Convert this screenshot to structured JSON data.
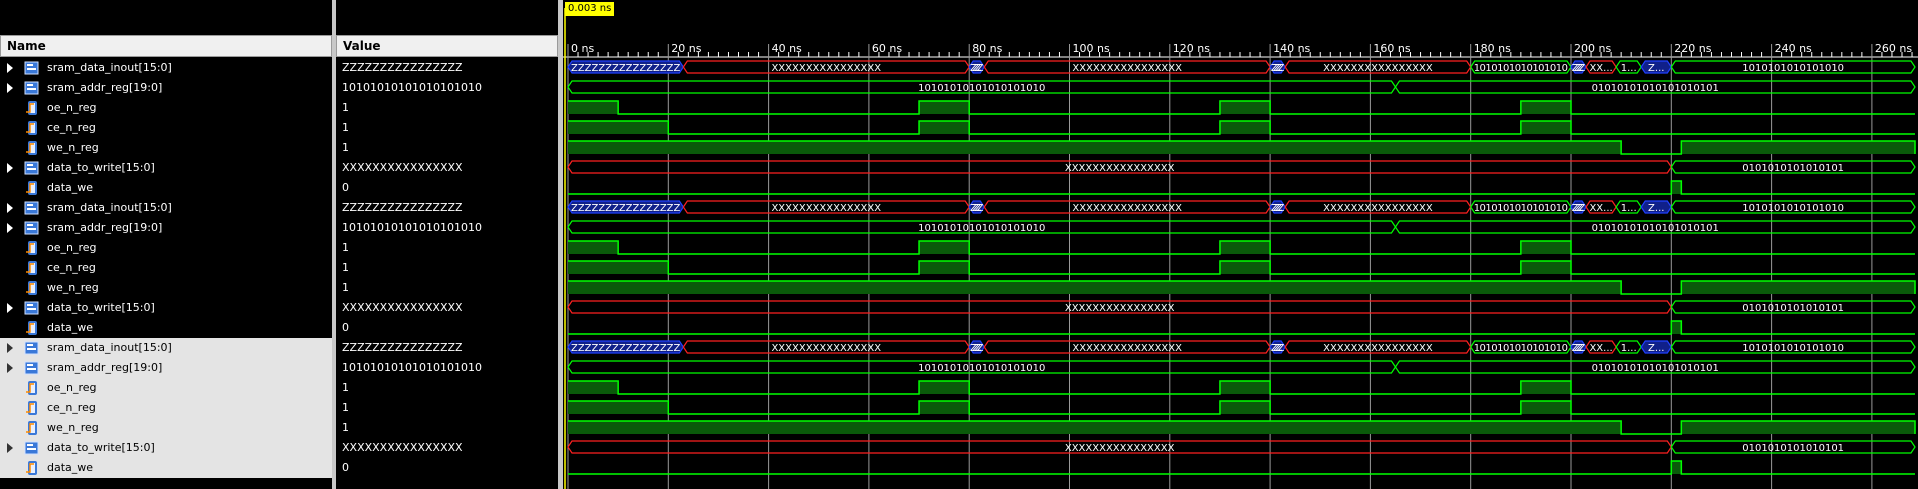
{
  "headers": {
    "name": "Name",
    "value": "Value"
  },
  "cursor": {
    "label": "0.003 ns"
  },
  "time_ticks": [
    "0 ns",
    "20 ns",
    "40 ns",
    "60 ns",
    "80 ns",
    "100 ns",
    "120 ns",
    "140 ns",
    "160 ns",
    "180 ns",
    "200 ns",
    "220 ns",
    "240 ns",
    "260 ns"
  ],
  "time_per_tick_ns": 20,
  "colors": {
    "bus_blue": "#2040ff",
    "bus_red": "#ff2020",
    "bus_green": "#00ff00",
    "grid": "#9a9a9a",
    "highlight_fill": "#0a5a0a"
  },
  "groups": [
    {
      "selected": false,
      "rows": [
        {
          "name": "sram_data_inout[15:0]",
          "value": "ZZZZZZZZZZZZZZZZ",
          "kind": "bus",
          "icon": "bus-icon",
          "segments": [
            {
              "from": 0,
              "to": 23,
              "state": "z",
              "label": "ZZZZZZZZZZZZZZZZ"
            },
            {
              "from": 23,
              "to": 80,
              "state": "x",
              "label": "XXXXXXXXXXXXXXXX"
            },
            {
              "from": 80,
              "to": 83,
              "state": "z",
              "label": "ZZZZ..."
            },
            {
              "from": 83,
              "to": 140,
              "state": "x",
              "label": "XXXXXXXXXXXXXXXX"
            },
            {
              "from": 140,
              "to": 143,
              "state": "z",
              "label": "ZZZZ..."
            },
            {
              "from": 143,
              "to": 180,
              "state": "x",
              "label": "XXXXXXXXXXXXXXXX"
            },
            {
              "from": 180,
              "to": 200,
              "state": "v",
              "label": "1010101010101010"
            },
            {
              "from": 200,
              "to": 203,
              "state": "z",
              "label": "ZZZZ..."
            },
            {
              "from": 203,
              "to": 209,
              "state": "x",
              "label": "XX..."
            },
            {
              "from": 209,
              "to": 214,
              "state": "v",
              "label": "1..."
            },
            {
              "from": 214,
              "to": 220,
              "state": "z",
              "label": "Z..."
            },
            {
              "from": 220,
              "to": 270,
              "state": "v",
              "label": "1010101010101010"
            }
          ]
        },
        {
          "name": "sram_addr_reg[19:0]",
          "value": "10101010101010101010",
          "kind": "bus",
          "icon": "bus-icon",
          "segments": [
            {
              "from": 0,
              "to": 165,
              "state": "v",
              "label": "10101010101010101010"
            },
            {
              "from": 165,
              "to": 270,
              "state": "v",
              "label": "01010101010101010101"
            }
          ]
        },
        {
          "name": "oe_n_reg",
          "value": "1",
          "kind": "bit",
          "icon": "bit-icon",
          "highs": [
            [
              0,
              10
            ],
            [
              70,
              80
            ],
            [
              130,
              140
            ],
            [
              190,
              200
            ]
          ]
        },
        {
          "name": "ce_n_reg",
          "value": "1",
          "kind": "bit",
          "icon": "bit-icon",
          "highs": [
            [
              0,
              20
            ],
            [
              70,
              80
            ],
            [
              130,
              140
            ],
            [
              190,
              200
            ]
          ]
        },
        {
          "name": "we_n_reg",
          "value": "1",
          "kind": "bit",
          "icon": "bit-icon",
          "highs": [
            [
              0,
              210
            ],
            [
              222,
              270
            ]
          ]
        },
        {
          "name": "data_to_write[15:0]",
          "value": "XXXXXXXXXXXXXXXX",
          "kind": "bus",
          "icon": "bus-icon",
          "segments": [
            {
              "from": 0,
              "to": 220,
              "state": "x",
              "label": "XXXXXXXXXXXXXXXX"
            },
            {
              "from": 220,
              "to": 270,
              "state": "v",
              "label": "0101010101010101"
            }
          ]
        },
        {
          "name": "data_we",
          "value": "0",
          "kind": "bit",
          "icon": "bit-icon",
          "highs": [
            [
              220,
              222
            ]
          ]
        }
      ]
    },
    {
      "selected": false,
      "rows": [
        {
          "name": "sram_data_inout[15:0]",
          "value": "ZZZZZZZZZZZZZZZZ",
          "kind": "bus",
          "icon": "bus-icon",
          "segments": [
            {
              "from": 0,
              "to": 23,
              "state": "z",
              "label": "ZZZZZZZZZZZZZZZZ"
            },
            {
              "from": 23,
              "to": 80,
              "state": "x",
              "label": "XXXXXXXXXXXXXXXX"
            },
            {
              "from": 80,
              "to": 83,
              "state": "z",
              "label": "ZZZZ..."
            },
            {
              "from": 83,
              "to": 140,
              "state": "x",
              "label": "XXXXXXXXXXXXXXXX"
            },
            {
              "from": 140,
              "to": 143,
              "state": "z",
              "label": "ZZZZ..."
            },
            {
              "from": 143,
              "to": 180,
              "state": "x",
              "label": "XXXXXXXXXXXXXXXX"
            },
            {
              "from": 180,
              "to": 200,
              "state": "v",
              "label": "1010101010101010"
            },
            {
              "from": 200,
              "to": 203,
              "state": "z",
              "label": "ZZZZ..."
            },
            {
              "from": 203,
              "to": 209,
              "state": "x",
              "label": "XX..."
            },
            {
              "from": 209,
              "to": 214,
              "state": "v",
              "label": "1..."
            },
            {
              "from": 214,
              "to": 220,
              "state": "z",
              "label": "Z..."
            },
            {
              "from": 220,
              "to": 270,
              "state": "v",
              "label": "1010101010101010"
            }
          ]
        },
        {
          "name": "sram_addr_reg[19:0]",
          "value": "10101010101010101010",
          "kind": "bus",
          "icon": "bus-icon",
          "segments": [
            {
              "from": 0,
              "to": 165,
              "state": "v",
              "label": "10101010101010101010"
            },
            {
              "from": 165,
              "to": 270,
              "state": "v",
              "label": "01010101010101010101"
            }
          ]
        },
        {
          "name": "oe_n_reg",
          "value": "1",
          "kind": "bit",
          "icon": "bit-icon",
          "highs": [
            [
              0,
              10
            ],
            [
              70,
              80
            ],
            [
              130,
              140
            ],
            [
              190,
              200
            ]
          ]
        },
        {
          "name": "ce_n_reg",
          "value": "1",
          "kind": "bit",
          "icon": "bit-icon",
          "highs": [
            [
              0,
              20
            ],
            [
              70,
              80
            ],
            [
              130,
              140
            ],
            [
              190,
              200
            ]
          ]
        },
        {
          "name": "we_n_reg",
          "value": "1",
          "kind": "bit",
          "icon": "bit-icon",
          "highs": [
            [
              0,
              210
            ],
            [
              222,
              270
            ]
          ]
        },
        {
          "name": "data_to_write[15:0]",
          "value": "XXXXXXXXXXXXXXXX",
          "kind": "bus",
          "icon": "bus-icon",
          "segments": [
            {
              "from": 0,
              "to": 220,
              "state": "x",
              "label": "XXXXXXXXXXXXXXXX"
            },
            {
              "from": 220,
              "to": 270,
              "state": "v",
              "label": "0101010101010101"
            }
          ]
        },
        {
          "name": "data_we",
          "value": "0",
          "kind": "bit",
          "icon": "bit-icon",
          "highs": [
            [
              220,
              222
            ]
          ]
        }
      ]
    },
    {
      "selected": true,
      "rows": [
        {
          "name": "sram_data_inout[15:0]",
          "value": "ZZZZZZZZZZZZZZZZ",
          "kind": "bus",
          "icon": "bus-icon",
          "segments": [
            {
              "from": 0,
              "to": 23,
              "state": "z",
              "label": "ZZZZZZZZZZZZZZZZ"
            },
            {
              "from": 23,
              "to": 80,
              "state": "x",
              "label": "XXXXXXXXXXXXXXXX"
            },
            {
              "from": 80,
              "to": 83,
              "state": "z",
              "label": "ZZZZ..."
            },
            {
              "from": 83,
              "to": 140,
              "state": "x",
              "label": "XXXXXXXXXXXXXXXX"
            },
            {
              "from": 140,
              "to": 143,
              "state": "z",
              "label": "ZZZZ..."
            },
            {
              "from": 143,
              "to": 180,
              "state": "x",
              "label": "XXXXXXXXXXXXXXXX"
            },
            {
              "from": 180,
              "to": 200,
              "state": "v",
              "label": "1010101010101010"
            },
            {
              "from": 200,
              "to": 203,
              "state": "z",
              "label": "ZZZZ..."
            },
            {
              "from": 203,
              "to": 209,
              "state": "x",
              "label": "XX..."
            },
            {
              "from": 209,
              "to": 214,
              "state": "v",
              "label": "1..."
            },
            {
              "from": 214,
              "to": 220,
              "state": "z",
              "label": "Z..."
            },
            {
              "from": 220,
              "to": 270,
              "state": "v",
              "label": "1010101010101010"
            }
          ]
        },
        {
          "name": "sram_addr_reg[19:0]",
          "value": "10101010101010101010",
          "kind": "bus",
          "icon": "bus-icon",
          "segments": [
            {
              "from": 0,
              "to": 165,
              "state": "v",
              "label": "10101010101010101010"
            },
            {
              "from": 165,
              "to": 270,
              "state": "v",
              "label": "01010101010101010101"
            }
          ]
        },
        {
          "name": "oe_n_reg",
          "value": "1",
          "kind": "bit",
          "icon": "bit-icon",
          "highs": [
            [
              0,
              10
            ],
            [
              70,
              80
            ],
            [
              130,
              140
            ],
            [
              190,
              200
            ]
          ]
        },
        {
          "name": "ce_n_reg",
          "value": "1",
          "kind": "bit",
          "icon": "bit-icon",
          "highs": [
            [
              0,
              20
            ],
            [
              70,
              80
            ],
            [
              130,
              140
            ],
            [
              190,
              200
            ]
          ]
        },
        {
          "name": "we_n_reg",
          "value": "1",
          "kind": "bit",
          "icon": "bit-icon",
          "highs": [
            [
              0,
              210
            ],
            [
              222,
              270
            ]
          ]
        },
        {
          "name": "data_to_write[15:0]",
          "value": "XXXXXXXXXXXXXXXX",
          "kind": "bus",
          "icon": "bus-icon",
          "segments": [
            {
              "from": 0,
              "to": 220,
              "state": "x",
              "label": "XXXXXXXXXXXXXXXX"
            },
            {
              "from": 220,
              "to": 270,
              "state": "v",
              "label": "0101010101010101"
            }
          ]
        },
        {
          "name": "data_we",
          "value": "0",
          "kind": "bit",
          "icon": "bit-icon",
          "highs": [
            [
              220,
              222
            ]
          ]
        }
      ]
    }
  ]
}
